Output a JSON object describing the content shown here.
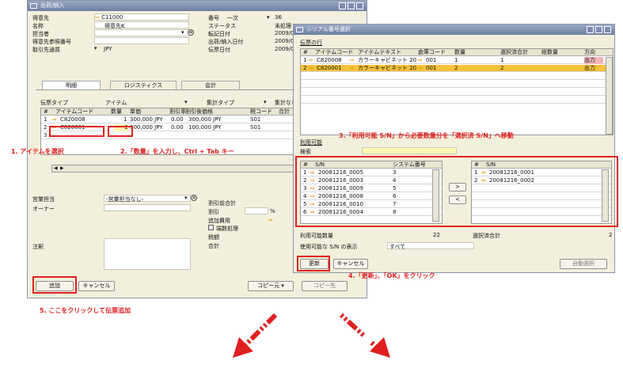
{
  "left_window": {
    "title": "出荷/納入",
    "fields": {
      "customer_label": "得意先",
      "customer_value": "C11000",
      "name_label": "名称",
      "name_value": "得意先K",
      "contact_label": "担当者",
      "ref_label": "得意先参照番号",
      "currency_label": "取引先通貨",
      "currency_value": "JPY",
      "number_label": "番号",
      "number_series": "一次",
      "number_value": "36",
      "status_label": "ステータス",
      "status_value": "未処理",
      "posting_label": "転記日付",
      "posting_value": "2009/0",
      "delivery_label": "出荷/納入日付",
      "delivery_value": "2009/0",
      "docdate_label": "伝票日付",
      "docdate_value": "2009/0"
    },
    "tabs": [
      "明細",
      "ロジスティクス",
      "会計"
    ],
    "doc_type_label": "伝票タイプ",
    "doc_type_value": "アイテム",
    "summary_type_label": "集計タイプ",
    "summary_extra": "集計なし",
    "table": {
      "headers": [
        "#",
        "アイテムコード",
        "数量",
        "単価",
        "割引率",
        "割引後価格",
        "税コード",
        "合計"
      ],
      "rows": [
        [
          "1",
          "C820008",
          "1",
          "300,000 JPY",
          "0.00",
          "300,000 JPY",
          "S01",
          ""
        ],
        [
          "2",
          "C820001",
          "2",
          "100,000 JPY",
          "0.00",
          "100,000 JPY",
          "S01",
          ""
        ],
        [
          "3",
          "",
          "",
          "",
          "",
          "",
          "",
          ""
        ]
      ]
    },
    "sales_rep_label": "営業担当",
    "sales_rep_value": "-営業担当なし-",
    "owner_label": "オーナー",
    "remarks_label": "注釈",
    "totals": {
      "before_discount": "割引前合計",
      "discount": "割引",
      "percent": "%",
      "freight": "追加費用",
      "rounding": "端数処理",
      "tax": "税額",
      "total": "合計"
    },
    "buttons": {
      "add": "追加",
      "cancel": "キャンセル",
      "copy_from": "コピー元",
      "copy_to": "コピー先"
    }
  },
  "right_window": {
    "title": "シリアル番号選択",
    "section_rows": "伝票の行",
    "top_table": {
      "headers": [
        "#",
        "アイテムコード",
        "アイテムテキスト",
        "倉庫コード",
        "数量",
        "選択済合計",
        "総数量",
        "方向"
      ],
      "rows": [
        [
          "1",
          "C820008",
          "カラーキャビネット 20",
          "001",
          "1",
          "1",
          "",
          "出力"
        ],
        [
          "2",
          "C820001",
          "カラーキャビネット 20",
          "001",
          "2",
          "2",
          "",
          "出力"
        ]
      ]
    },
    "available_label": "利用可能",
    "search_label": "検索",
    "available_table": {
      "headers": [
        "#",
        "S/N",
        "システム番号"
      ],
      "rows": [
        [
          "1",
          "20081216_0005",
          "3"
        ],
        [
          "2",
          "20081216_0003",
          "4"
        ],
        [
          "3",
          "20081216_0009",
          "5"
        ],
        [
          "4",
          "20081216_0008",
          "6"
        ],
        [
          "5",
          "20081216_0010",
          "7"
        ],
        [
          "6",
          "20081216_0004",
          "8"
        ]
      ]
    },
    "selected_table": {
      "headers": [
        "#",
        "S/N"
      ],
      "rows": [
        [
          "1",
          "20081216_0001"
        ],
        [
          "2",
          "20081216_0002"
        ]
      ]
    },
    "move_right": ">",
    "move_left": "<",
    "available_qty_label": "利用可能数量",
    "available_qty_value": "22",
    "selected_total_label": "選択済合計",
    "selected_total_value": "2",
    "show_sn_label": "使用可能な S/N の表示",
    "show_sn_value": "すべて",
    "buttons": {
      "update": "更新",
      "cancel": "キャンセル",
      "auto_select": "自動選択"
    }
  },
  "annotations": {
    "step1": "1. アイテムを選択",
    "step2": "2.「数量」を入力し、Ctrl + Tab キー",
    "step3": "3.「利用可能 S/N」から必要数量分を「選択済 S/N」へ移動",
    "step4": "4.「更新」、「OK」をクリック",
    "step5": "5. ここをクリックして伝票追加"
  },
  "colors": {
    "accent_red": "#e02020",
    "highlight_row": "#f7c23a",
    "title_blue": "#7788aa",
    "window_bg": "#f2efdc"
  }
}
